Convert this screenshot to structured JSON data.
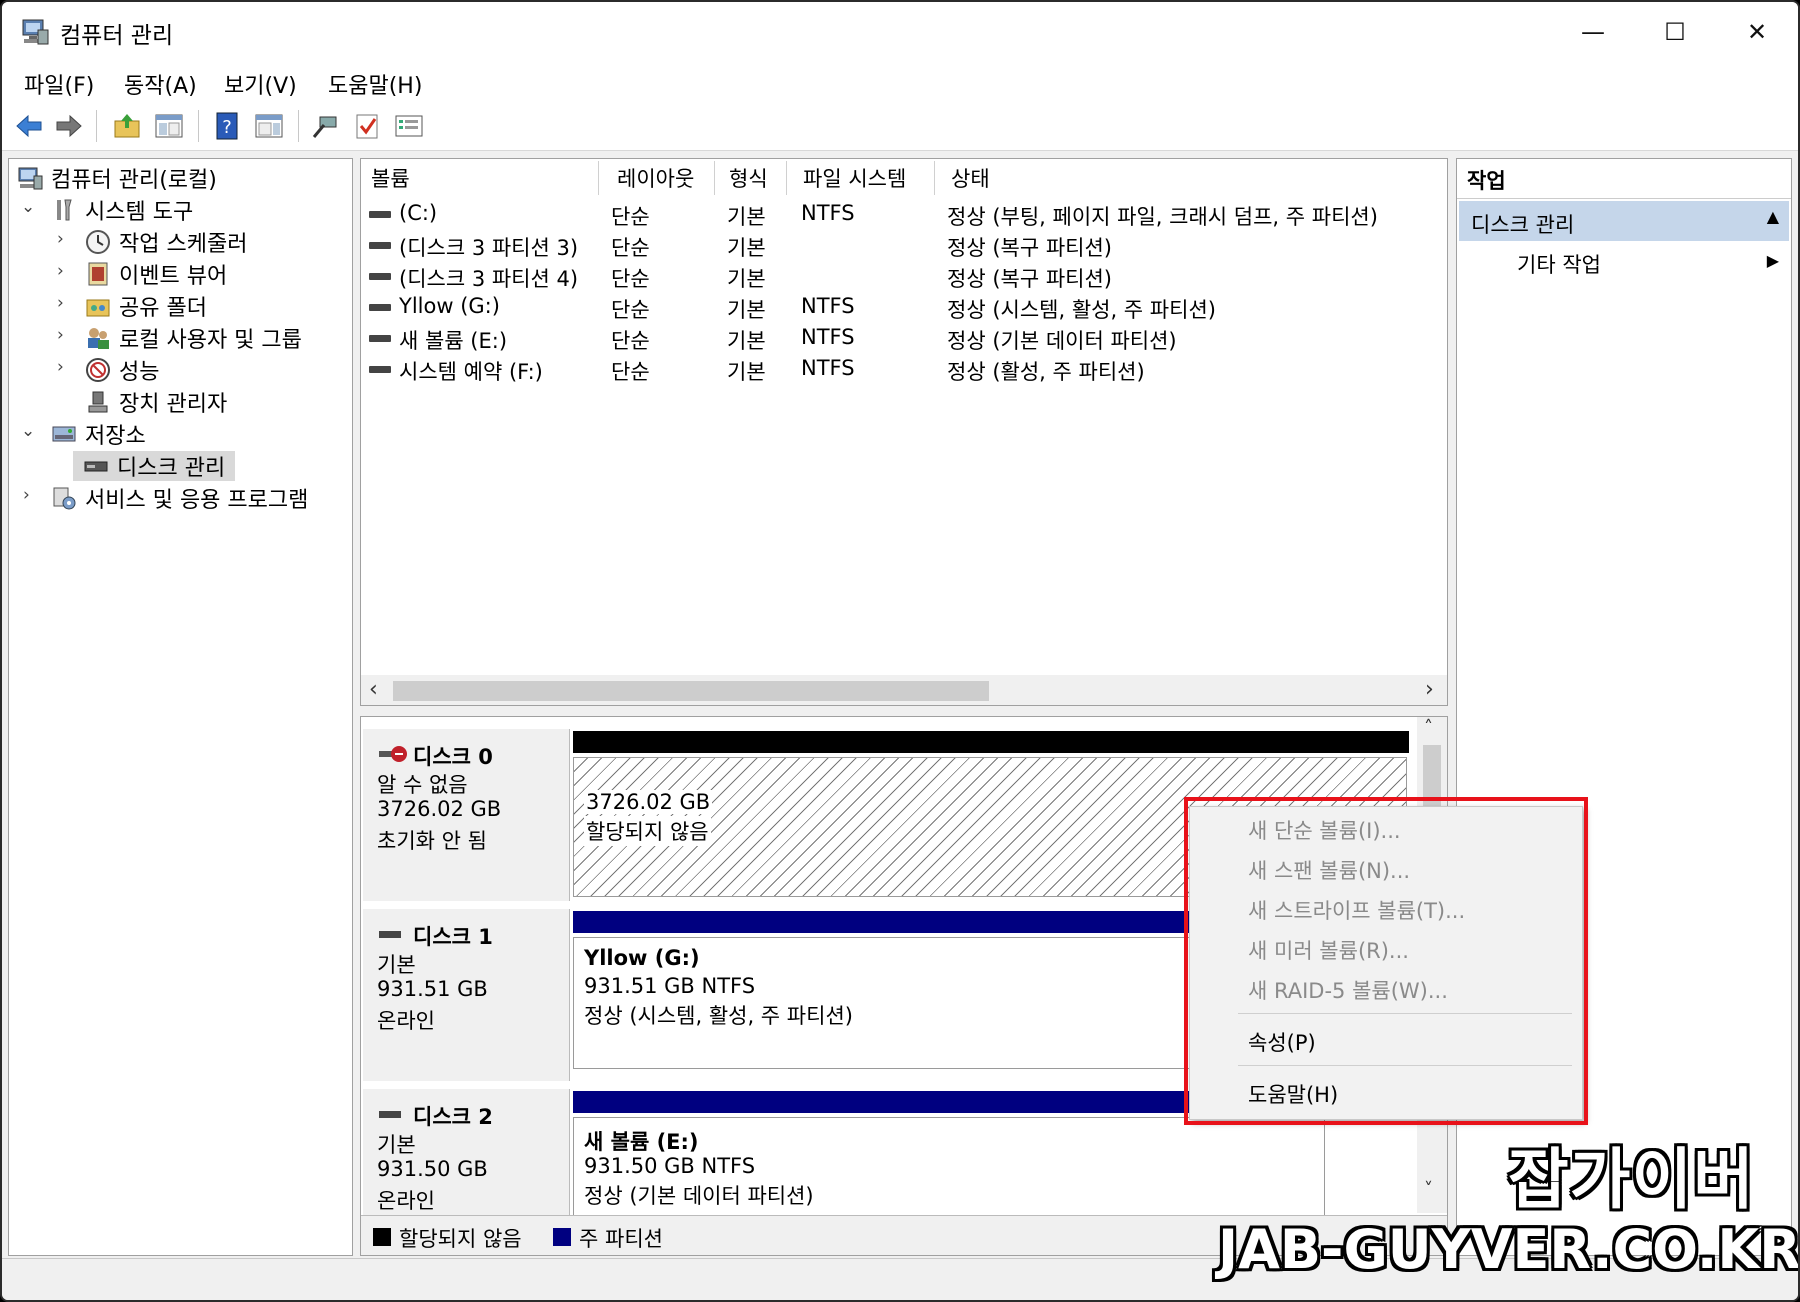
{
  "window": {
    "title": "컴퓨터 관리",
    "controls": {
      "minimize": "—",
      "maximize": "☐",
      "close": "✕"
    }
  },
  "menu": [
    "파일(F)",
    "동작(A)",
    "보기(V)",
    "도움말(H)"
  ],
  "toolbar_icons": [
    "back-arrow-icon",
    "forward-arrow-icon",
    "up-folder-icon",
    "show-hide-tree-icon",
    "help-icon",
    "show-action-pane-icon",
    "connect-icon",
    "check-icon",
    "properties-list-icon"
  ],
  "tree": {
    "root": "컴퓨터 관리(로컬)",
    "system_tools": "시스템 도구",
    "task_scheduler": "작업 스케줄러",
    "event_viewer": "이벤트 뷰어",
    "shared_folders": "공유 폴더",
    "local_users": "로컬 사용자 및 그룹",
    "performance": "성능",
    "device_manager": "장치 관리자",
    "storage": "저장소",
    "disk_management": "디스크 관리",
    "services": "서비스 및 응용 프로그램"
  },
  "volume_list": {
    "columns": [
      "볼륨",
      "레이아웃",
      "형식",
      "파일 시스템",
      "상태"
    ],
    "rows": [
      {
        "volume": "(C:)",
        "layout": "단순",
        "type": "기본",
        "fs": "NTFS",
        "status": "정상 (부팅, 페이지 파일, 크래시 덤프, 주 파티션)"
      },
      {
        "volume": "(디스크 3 파티션 3)",
        "layout": "단순",
        "type": "기본",
        "fs": "",
        "status": "정상 (복구 파티션)"
      },
      {
        "volume": "(디스크 3 파티션 4)",
        "layout": "단순",
        "type": "기본",
        "fs": "",
        "status": "정상 (복구 파티션)"
      },
      {
        "volume": "Yllow (G:)",
        "layout": "단순",
        "type": "기본",
        "fs": "NTFS",
        "status": "정상 (시스템, 활성, 주 파티션)"
      },
      {
        "volume": "새 볼륨 (E:)",
        "layout": "단순",
        "type": "기본",
        "fs": "NTFS",
        "status": "정상 (기본 데이터 파티션)"
      },
      {
        "volume": "시스템 예약 (F:)",
        "layout": "단순",
        "type": "기본",
        "fs": "NTFS",
        "status": "정상 (활성, 주 파티션)"
      }
    ]
  },
  "disks": [
    {
      "name": "디스크 0",
      "kind": "알 수 없음",
      "size": "3726.02 GB",
      "state": "초기화 안 됨",
      "partition": {
        "title": "",
        "line1": "3726.02 GB",
        "line2": "할당되지 않음"
      }
    },
    {
      "name": "디스크 1",
      "kind": "기본",
      "size": "931.51 GB",
      "state": "온라인",
      "partition": {
        "title": "Yllow  (G:)",
        "line1": "931.51 GB NTFS",
        "line2": "정상 (시스템, 활성, 주 파티션)"
      }
    },
    {
      "name": "디스크 2",
      "kind": "기본",
      "size": "931.50 GB",
      "state": "온라인",
      "partition": {
        "title": "새 볼륨  (E:)",
        "line1": "931.50 GB NTFS",
        "line2": "정상 (기본 데이터 파티션)"
      }
    }
  ],
  "legend": {
    "unallocated": "할당되지 않음",
    "primary": "주 파티션"
  },
  "actions": {
    "header": "작업",
    "section": "디스크 관리",
    "more": "기타 작업"
  },
  "context_menu": {
    "disabled": [
      "새 단순 볼륨(I)...",
      "새 스팬 볼륨(N)...",
      "새 스트라이프 볼륨(T)...",
      "새 미러 볼륨(R)...",
      "새 RAID-5 볼륨(W)..."
    ],
    "properties": "속성(P)",
    "help": "도움말(H)"
  },
  "watermark": {
    "korean": "잡가이버",
    "url": "JAB-GUYVER.CO.KR"
  },
  "colors": {
    "primary_partition": "#000080",
    "unallocated": "#000000",
    "selected": "#cce8ff",
    "highlight_box": "#e8121a",
    "action_section": "#c5d6ea"
  }
}
